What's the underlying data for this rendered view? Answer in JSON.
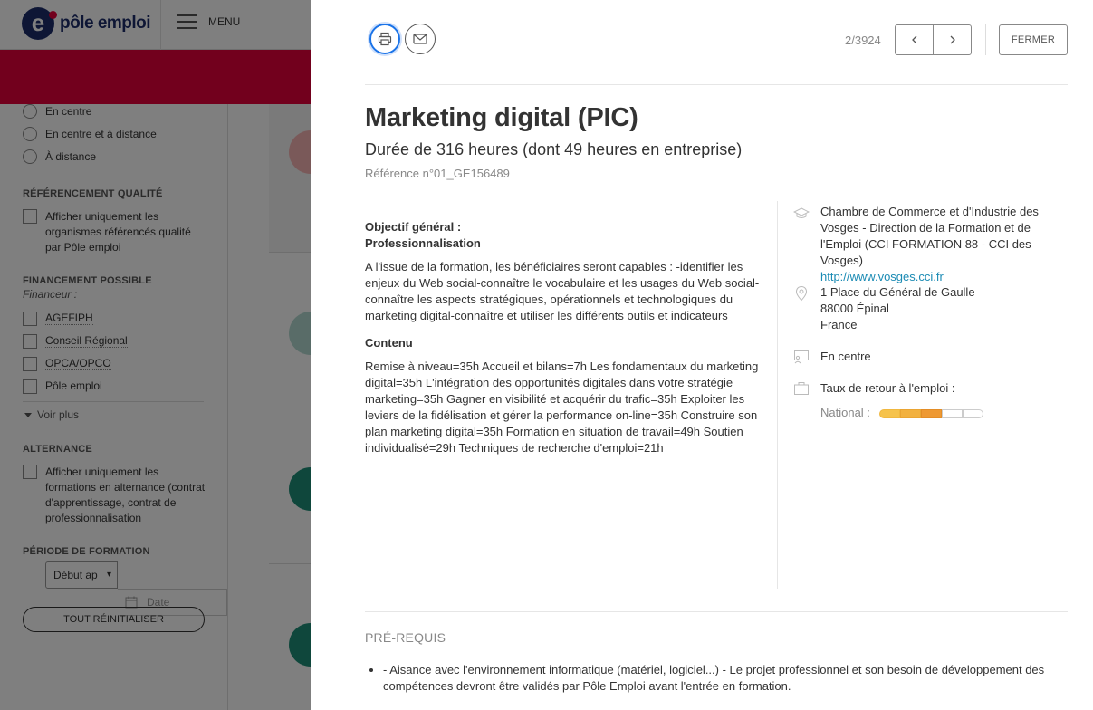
{
  "header": {
    "logo_text": "pôle emploi",
    "menu_label": "MENU"
  },
  "sidebar": {
    "radios": [
      "En centre",
      "En centre et à distance",
      "À distance"
    ],
    "quality_title": "RÉFÉRENCEMENT QUALITÉ",
    "quality_check": "Afficher uniquement les organismes référencés qualité par Pôle emploi",
    "funding_title": "FINANCEMENT POSSIBLE",
    "funding_sub": "Financeur :",
    "funders": [
      "AGEFIPH",
      "Conseil Régional",
      "OPCA/OPCO",
      "Pôle emploi"
    ],
    "see_more": "Voir plus",
    "alternance_title": "ALTERNANCE",
    "alternance_check": "Afficher uniquement les formations en alternance (contrat d'apprentissage, contrat de professionnalisation",
    "period_title": "PÉRIODE DE FORMATION",
    "period_select": "Début ap",
    "date_placeholder": "Date",
    "reset_label": "TOUT RÉINITIALISER"
  },
  "modal": {
    "print_icon": "printer-icon",
    "mail_icon": "envelope-icon",
    "pager": "2/3924",
    "close_label": "FERMER",
    "title": "Marketing digital (PIC)",
    "subtitle": "Durée de 316 heures (dont 49 heures en entreprise)",
    "reference": "Référence n°01_GE156489",
    "objective_label": "Objectif général :",
    "objective_value": "Professionnalisation",
    "objective_text": "A l'issue de la formation, les bénéficiaires seront capables : -identifier les enjeux du Web social-connaître le vocabulaire et les usages du Web social-connaître les aspects stratégiques, opérationnels et technologiques du marketing digital-connaître et utiliser les différents outils et indicateurs",
    "content_label": "Contenu",
    "content_text": "Remise à niveau=35h Accueil et bilans=7h Les fondamentaux du marketing digital=35h L'intégration des opportunités digitales dans votre stratégie marketing=35h Gagner en visibilité et acquérir du trafic=35h Exploiter les leviers de la fidélisation et gérer la performance on-line=35h Construire son plan marketing digital=35h Formation en situation de travail=49h Soutien individualisé=29h Techniques de recherche d'emploi=21h",
    "organism": "Chambre de Commerce et d'Industrie des Vosges - Direction de la Formation et de l'Emploi (CCI FORMATION 88 - CCI des Vosges)",
    "website": "http://www.vosges.cci.fr",
    "address_line1": "1 Place du Général de Gaulle",
    "address_line2": "88000 Épinal",
    "address_line3": "France",
    "mode": "En centre",
    "return_label": "Taux de retour à l'emploi :",
    "national_label": "National :",
    "national_rating": 3,
    "national_rating_max": 5,
    "prereq_title": "PRÉ-REQUIS",
    "prereq_items": [
      "- Aisance avec l'environnement informatique (matériel, logiciel...) - Le projet professionnel et son besoin de développement des compétences devront être validés par Pôle Emploi avant l'entrée en formation."
    ]
  }
}
